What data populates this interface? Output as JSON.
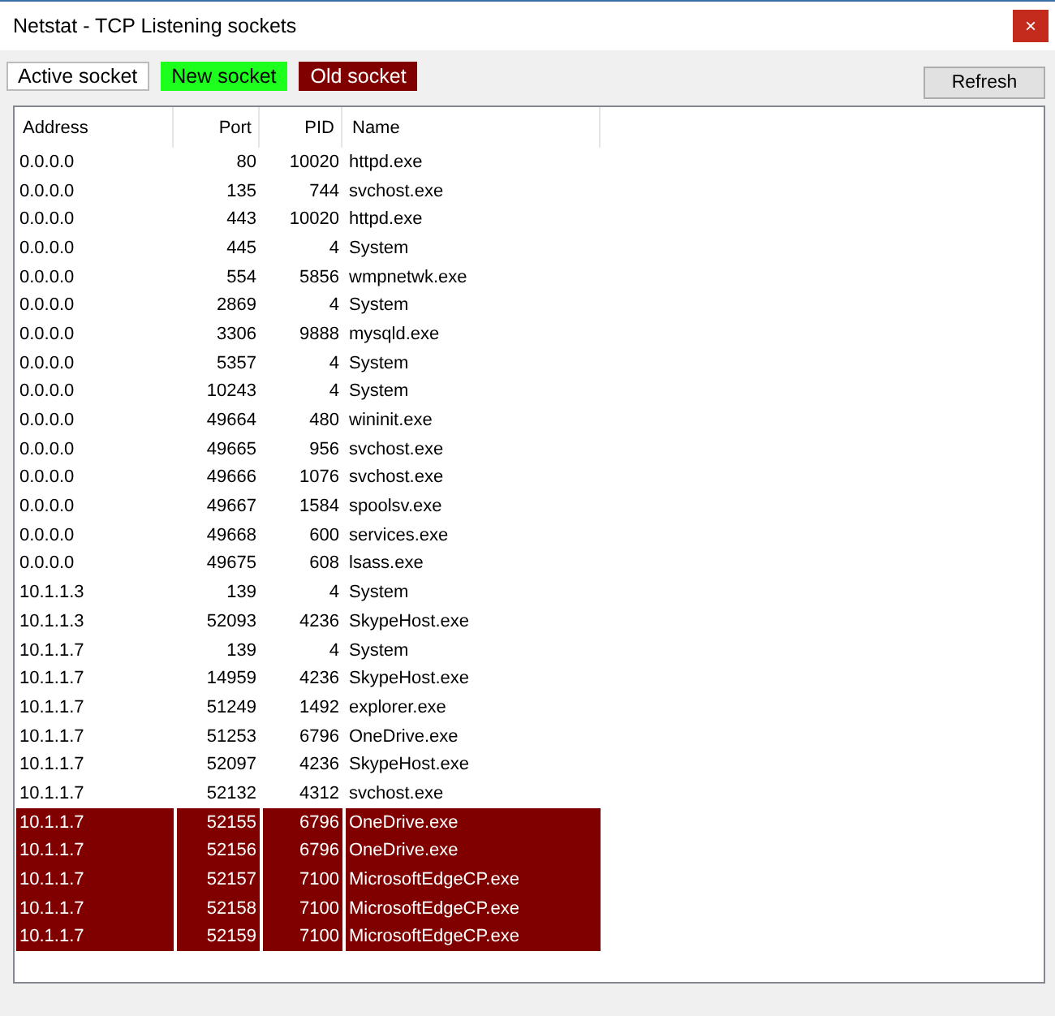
{
  "window": {
    "title": "Netstat - TCP Listening sockets",
    "close": "×"
  },
  "legend": [
    {
      "label": "Active socket",
      "kind": "active"
    },
    {
      "label": "New socket",
      "kind": "new"
    },
    {
      "label": "Old socket",
      "kind": "old"
    }
  ],
  "refresh_button": "Refresh",
  "table": {
    "columns": [
      "Address",
      "Port",
      "PID",
      "Name"
    ],
    "rows": [
      {
        "kind": "active",
        "cells": [
          "0.0.0.0",
          "80",
          "10020",
          "httpd.exe"
        ]
      },
      {
        "kind": "active",
        "cells": [
          "0.0.0.0",
          "135",
          "744",
          "svchost.exe"
        ]
      },
      {
        "kind": "active",
        "cells": [
          "0.0.0.0",
          "443",
          "10020",
          "httpd.exe"
        ]
      },
      {
        "kind": "active",
        "cells": [
          "0.0.0.0",
          "445",
          "4",
          "System"
        ]
      },
      {
        "kind": "active",
        "cells": [
          "0.0.0.0",
          "554",
          "5856",
          "wmpnetwk.exe"
        ]
      },
      {
        "kind": "active",
        "cells": [
          "0.0.0.0",
          "2869",
          "4",
          "System"
        ]
      },
      {
        "kind": "active",
        "cells": [
          "0.0.0.0",
          "3306",
          "9888",
          "mysqld.exe"
        ]
      },
      {
        "kind": "active",
        "cells": [
          "0.0.0.0",
          "5357",
          "4",
          "System"
        ]
      },
      {
        "kind": "active",
        "cells": [
          "0.0.0.0",
          "10243",
          "4",
          "System"
        ]
      },
      {
        "kind": "active",
        "cells": [
          "0.0.0.0",
          "49664",
          "480",
          "wininit.exe"
        ]
      },
      {
        "kind": "active",
        "cells": [
          "0.0.0.0",
          "49665",
          "956",
          "svchost.exe"
        ]
      },
      {
        "kind": "active",
        "cells": [
          "0.0.0.0",
          "49666",
          "1076",
          "svchost.exe"
        ]
      },
      {
        "kind": "active",
        "cells": [
          "0.0.0.0",
          "49667",
          "1584",
          "spoolsv.exe"
        ]
      },
      {
        "kind": "active",
        "cells": [
          "0.0.0.0",
          "49668",
          "600",
          "services.exe"
        ]
      },
      {
        "kind": "active",
        "cells": [
          "0.0.0.0",
          "49675",
          "608",
          "lsass.exe"
        ]
      },
      {
        "kind": "active",
        "cells": [
          "10.1.1.3",
          "139",
          "4",
          "System"
        ]
      },
      {
        "kind": "active",
        "cells": [
          "10.1.1.3",
          "52093",
          "4236",
          "SkypeHost.exe"
        ]
      },
      {
        "kind": "active",
        "cells": [
          "10.1.1.7",
          "139",
          "4",
          "System"
        ]
      },
      {
        "kind": "active",
        "cells": [
          "10.1.1.7",
          "14959",
          "4236",
          "SkypeHost.exe"
        ]
      },
      {
        "kind": "active",
        "cells": [
          "10.1.1.7",
          "51249",
          "1492",
          "explorer.exe"
        ]
      },
      {
        "kind": "active",
        "cells": [
          "10.1.1.7",
          "51253",
          "6796",
          "OneDrive.exe"
        ]
      },
      {
        "kind": "active",
        "cells": [
          "10.1.1.7",
          "52097",
          "4236",
          "SkypeHost.exe"
        ]
      },
      {
        "kind": "active",
        "cells": [
          "10.1.1.7",
          "52132",
          "4312",
          "svchost.exe"
        ]
      },
      {
        "kind": "old",
        "cells": [
          "10.1.1.7",
          "52155",
          "6796",
          "OneDrive.exe"
        ]
      },
      {
        "kind": "old",
        "cells": [
          "10.1.1.7",
          "52156",
          "6796",
          "OneDrive.exe"
        ]
      },
      {
        "kind": "old",
        "cells": [
          "10.1.1.7",
          "52157",
          "7100",
          "MicrosoftEdgeCP.exe"
        ]
      },
      {
        "kind": "old",
        "cells": [
          "10.1.1.7",
          "52158",
          "7100",
          "MicrosoftEdgeCP.exe"
        ]
      },
      {
        "kind": "old",
        "cells": [
          "10.1.1.7",
          "52159",
          "7100",
          "MicrosoftEdgeCP.exe"
        ]
      }
    ]
  }
}
